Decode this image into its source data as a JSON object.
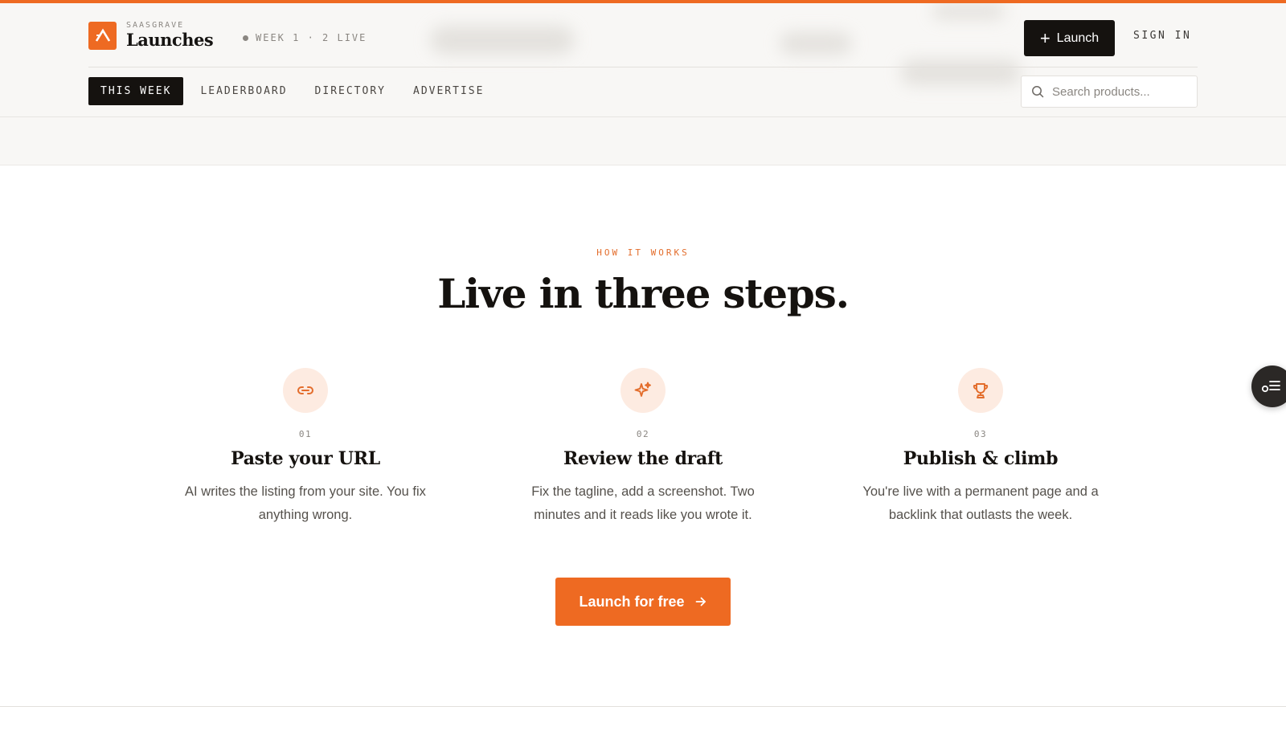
{
  "brand": {
    "overline": "SAASGRAVE",
    "name": "Launches",
    "accent_color": "#ee6a22"
  },
  "status": {
    "text": "WEEK 1 · 2 LIVE"
  },
  "header": {
    "launch_label": "Launch",
    "signin_label": "SIGN IN"
  },
  "nav": {
    "items": [
      {
        "label": "THIS WEEK",
        "active": true
      },
      {
        "label": "LEADERBOARD",
        "active": false
      },
      {
        "label": "DIRECTORY",
        "active": false
      },
      {
        "label": "ADVERTISE",
        "active": false
      }
    ]
  },
  "search": {
    "placeholder": "Search products...",
    "value": "",
    "icon": "search-icon"
  },
  "section": {
    "eyebrow": "HOW IT WORKS",
    "headline": "Live in three steps."
  },
  "steps": [
    {
      "number": "01",
      "title": "Paste your URL",
      "description": "AI writes the listing from your site. You fix anything wrong.",
      "icon": "link-icon"
    },
    {
      "number": "02",
      "title": "Review the draft",
      "description": "Fix the tagline, add a screenshot. Two minutes and it reads like you wrote it.",
      "icon": "sparkle-icon"
    },
    {
      "number": "03",
      "title": "Publish & climb",
      "description": "You're live with a permanent page and a backlink that outlasts the week.",
      "icon": "trophy-icon"
    }
  ],
  "cta": {
    "label": "Launch for free",
    "icon": "arrow-right-icon"
  },
  "floating": {
    "icon": "toggle-list-icon"
  }
}
